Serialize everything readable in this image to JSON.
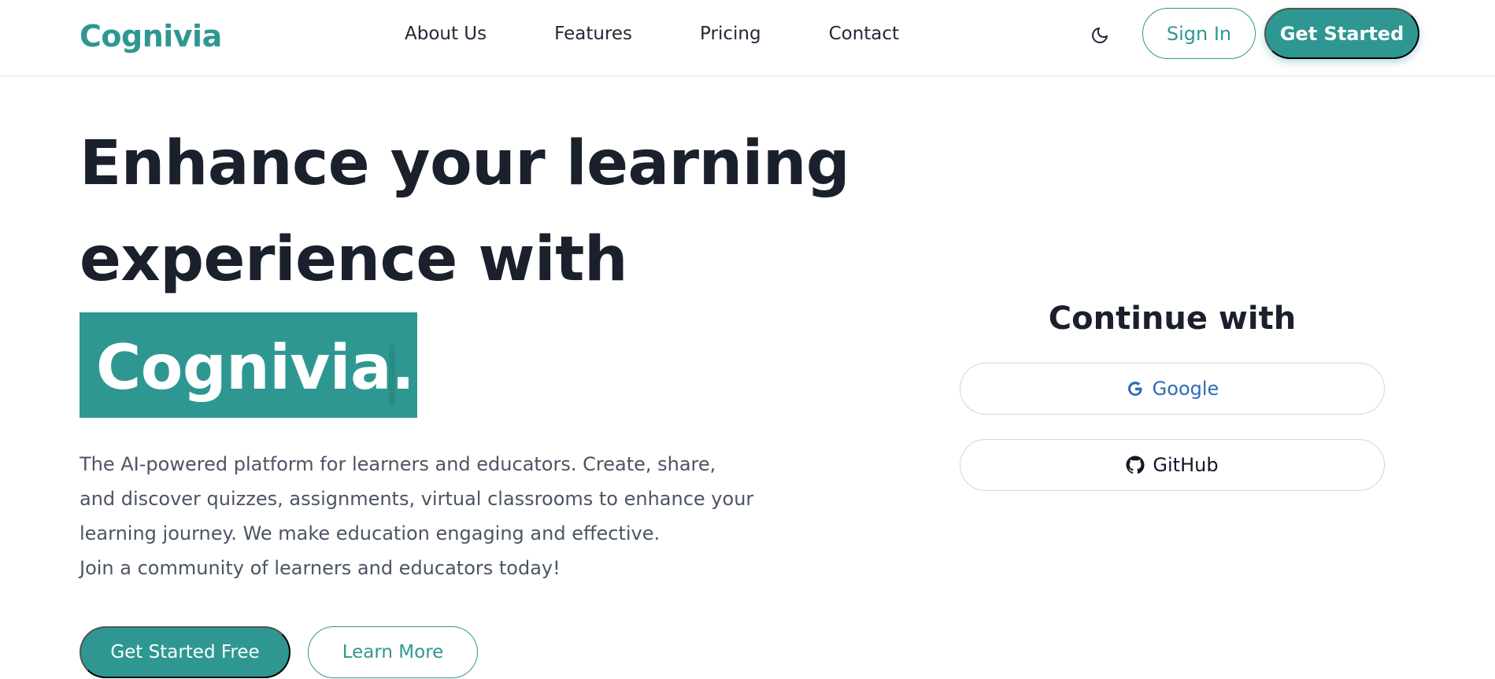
{
  "brand": {
    "name": "Cognivia"
  },
  "nav": {
    "items": [
      {
        "label": "About Us"
      },
      {
        "label": "Features"
      },
      {
        "label": "Pricing"
      },
      {
        "label": "Contact"
      }
    ]
  },
  "header": {
    "theme_icon": "moon-icon",
    "signin_label": "Sign In",
    "get_started_label": "Get Started"
  },
  "hero": {
    "line1": "Enhance your learning",
    "line2": "experience with",
    "highlight": "Cognivia.",
    "description_lines": [
      "The AI-powered platform for learners and educators. Create, share,",
      "and discover quizzes, assignments, virtual classrooms to enhance your",
      "learning journey. We make education engaging and effective.",
      "Join a community of learners and educators today!"
    ],
    "primary_cta": "Get Started Free",
    "secondary_cta": "Learn More"
  },
  "auth": {
    "title": "Continue with",
    "providers": [
      {
        "label": "Google",
        "icon": "google-icon"
      },
      {
        "label": "GitHub",
        "icon": "github-icon"
      }
    ]
  },
  "colors": {
    "accent": "#2f9791",
    "text_dark": "#1a202c",
    "text_muted": "#4b5563",
    "google_blue": "#2f6db5"
  }
}
